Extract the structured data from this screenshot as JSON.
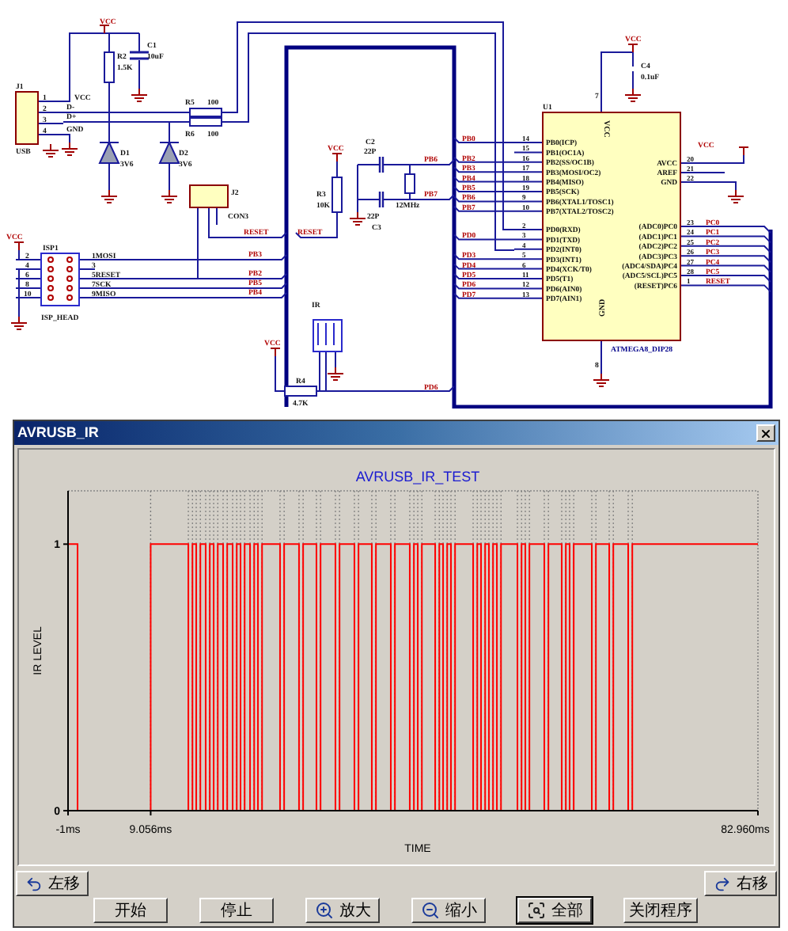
{
  "schematic": {
    "labels": [
      {
        "kind": "power",
        "text": "VCC"
      },
      {
        "kind": "ref",
        "text": "C1"
      },
      {
        "kind": "ref",
        "text": "10uF"
      },
      {
        "kind": "ref",
        "text": "R2"
      },
      {
        "kind": "ref",
        "text": "1.5K"
      },
      {
        "kind": "ref",
        "text": "J1"
      },
      {
        "kind": "pin",
        "text": "1"
      },
      {
        "kind": "pin",
        "text": "2"
      },
      {
        "kind": "pin",
        "text": "3"
      },
      {
        "kind": "pin",
        "text": "4"
      },
      {
        "kind": "ref",
        "text": "VCC"
      },
      {
        "kind": "ref",
        "text": "D-"
      },
      {
        "kind": "ref",
        "text": "D+"
      },
      {
        "kind": "ref",
        "text": "GND"
      },
      {
        "kind": "ref",
        "text": "USB"
      },
      {
        "kind": "ref",
        "text": "R5"
      },
      {
        "kind": "ref",
        "text": "100"
      },
      {
        "kind": "ref",
        "text": "R6"
      },
      {
        "kind": "ref",
        "text": "100"
      },
      {
        "kind": "ref",
        "text": "D1"
      },
      {
        "kind": "ref",
        "text": "3V6"
      },
      {
        "kind": "ref",
        "text": "D2"
      },
      {
        "kind": "ref",
        "text": "3V6"
      },
      {
        "kind": "ref",
        "text": "J2"
      },
      {
        "kind": "ref",
        "text": "CON3"
      },
      {
        "kind": "power",
        "text": "VCC"
      },
      {
        "kind": "ref",
        "text": "ISP1"
      },
      {
        "kind": "pin",
        "text": "2"
      },
      {
        "kind": "pin",
        "text": "4"
      },
      {
        "kind": "pin",
        "text": "6"
      },
      {
        "kind": "pin",
        "text": "8"
      },
      {
        "kind": "pin",
        "text": "10"
      },
      {
        "kind": "ref",
        "text": "1MOSI"
      },
      {
        "kind": "ref",
        "text": "3"
      },
      {
        "kind": "ref",
        "text": "5RESET"
      },
      {
        "kind": "ref",
        "text": "7SCK"
      },
      {
        "kind": "ref",
        "text": "9MISO"
      },
      {
        "kind": "ref",
        "text": "ISP_HEAD"
      },
      {
        "kind": "net",
        "text": "RESET"
      },
      {
        "kind": "net",
        "text": "RESET"
      },
      {
        "kind": "net",
        "text": "PB3"
      },
      {
        "kind": "net",
        "text": "PB2"
      },
      {
        "kind": "net",
        "text": "PB5"
      },
      {
        "kind": "net",
        "text": "PB4"
      },
      {
        "kind": "power",
        "text": "VCC"
      },
      {
        "kind": "ref",
        "text": "R3"
      },
      {
        "kind": "ref",
        "text": "10K"
      },
      {
        "kind": "ref",
        "text": "C2"
      },
      {
        "kind": "ref",
        "text": "22P"
      },
      {
        "kind": "ref",
        "text": "22P"
      },
      {
        "kind": "ref",
        "text": "C3"
      },
      {
        "kind": "ref",
        "text": "12MHz"
      },
      {
        "kind": "net",
        "text": "PB6"
      },
      {
        "kind": "net",
        "text": "PB7"
      },
      {
        "kind": "ref",
        "text": "IR"
      },
      {
        "kind": "power",
        "text": "VCC"
      },
      {
        "kind": "ref",
        "text": "R4"
      },
      {
        "kind": "ref",
        "text": "4.7K"
      },
      {
        "kind": "net",
        "text": "PD6"
      },
      {
        "kind": "power",
        "text": "VCC"
      },
      {
        "kind": "ref",
        "text": "C4"
      },
      {
        "kind": "ref",
        "text": "0.1uF"
      },
      {
        "kind": "pin",
        "text": "7"
      },
      {
        "kind": "ref",
        "text": "U1"
      },
      {
        "kind": "power",
        "text": "VCC"
      },
      {
        "kind": "chip",
        "text": "ATMEGA8_DIP28"
      },
      {
        "kind": "pin",
        "text": "8"
      }
    ],
    "chip": {
      "power_label": "VCC",
      "ground_label": "GND",
      "left_pins": [
        {
          "num": "14",
          "name": "PB0(ICP)",
          "net": "PB0"
        },
        {
          "num": "15",
          "name": "PB1(OC1A)"
        },
        {
          "num": "16",
          "name": "PB2(SS/OC1B)",
          "net": "PB2"
        },
        {
          "num": "17",
          "name": "PB3(MOSI/OC2)",
          "net": "PB3"
        },
        {
          "num": "18",
          "name": "PB4(MISO)",
          "net": "PB4"
        },
        {
          "num": "19",
          "name": "PB5(SCK)",
          "net": "PB5"
        },
        {
          "num": "9",
          "name": "PB6(XTAL1/TOSC1)",
          "net": "PB6"
        },
        {
          "num": "10",
          "name": "PB7(XTAL2/TOSC2)",
          "net": "PB7"
        },
        {
          "num": "2",
          "name": "PD0(RXD)"
        },
        {
          "num": "3",
          "name": "PD1(TXD)",
          "net": "PD0"
        },
        {
          "num": "4",
          "name": "PD2(INT0)"
        },
        {
          "num": "5",
          "name": "PD3(INT1)",
          "net": "PD3"
        },
        {
          "num": "6",
          "name": "PD4(XCK/T0)",
          "net": "PD4"
        },
        {
          "num": "11",
          "name": "PD5(T1)",
          "net": "PD5"
        },
        {
          "num": "12",
          "name": "PD6(AIN0)",
          "net": "PD6"
        },
        {
          "num": "13",
          "name": "PD7(AIN1)",
          "net": "PD7"
        }
      ],
      "right_pins": [
        {
          "num": "20",
          "name": "AVCC"
        },
        {
          "num": "21",
          "name": "AREF"
        },
        {
          "num": "22",
          "name": "GND"
        },
        {
          "num": "23",
          "name": "(ADC0)PC0",
          "net": "PC0"
        },
        {
          "num": "24",
          "name": "(ADC1)PC1",
          "net": "PC1"
        },
        {
          "num": "25",
          "name": "(ADC2)PC2",
          "net": "PC2"
        },
        {
          "num": "26",
          "name": "(ADC3)PC3",
          "net": "PC3"
        },
        {
          "num": "27",
          "name": "(ADC4/SDA)PC4",
          "net": "PC4"
        },
        {
          "num": "28",
          "name": "(ADC5/SCL)PC5",
          "net": "PC5"
        },
        {
          "num": "1",
          "name": "(RESET)PC6",
          "net": "RESET"
        }
      ]
    }
  },
  "window": {
    "title": "AVRUSB_IR",
    "chart": {
      "chart_data": {
        "type": "line",
        "title": "AVRUSB_IR_TEST",
        "xlabel": "TIME",
        "ylabel": "IR LEVEL",
        "xlim": [
          -1,
          82.96
        ],
        "ylim": [
          0,
          1.2
        ],
        "xticks": [
          {
            "value": -1,
            "label": "-1ms"
          },
          {
            "value": 9.056,
            "label": "9.056ms"
          },
          {
            "value": 82.96,
            "label": "82.960ms"
          }
        ],
        "yticks": [
          0,
          1
        ],
        "x": [
          -1,
          0.16,
          0.16,
          9.056,
          9.056,
          13.64,
          13.64,
          14.14,
          14.14,
          14.6,
          14.6,
          15.1,
          15.1,
          15.75,
          15.75,
          16.25,
          16.25,
          16.72,
          16.72,
          17.22,
          17.22,
          17.87,
          17.87,
          18.37,
          18.37,
          19.03,
          19.03,
          19.53,
          19.53,
          19.99,
          19.99,
          20.49,
          20.49,
          21.15,
          21.15,
          21.65,
          21.65,
          22.11,
          22.11,
          22.61,
          22.61,
          24.8,
          24.8,
          25.3,
          25.3,
          27.11,
          27.11,
          27.61,
          27.61,
          29.23,
          29.23,
          29.73,
          29.73,
          31.54,
          31.54,
          32.04,
          32.04,
          33.85,
          33.85,
          34.35,
          34.35,
          35.97,
          35.97,
          36.47,
          36.47,
          38.28,
          38.28,
          38.78,
          38.78,
          40.59,
          40.59,
          41.09,
          41.09,
          41.56,
          41.56,
          42.06,
          42.06,
          43.68,
          43.68,
          44.18,
          44.18,
          44.64,
          44.64,
          45.14,
          45.14,
          45.6,
          45.6,
          46.1,
          46.1,
          48.3,
          48.3,
          48.8,
          48.8,
          49.26,
          49.26,
          49.76,
          49.76,
          50.22,
          50.22,
          50.72,
          50.72,
          51.19,
          51.19,
          51.69,
          51.69,
          53.69,
          53.69,
          54.19,
          54.19,
          54.65,
          54.65,
          55.15,
          55.15,
          56.96,
          56.96,
          57.46,
          57.46,
          59.08,
          59.08,
          59.58,
          59.58,
          60.04,
          60.04,
          60.54,
          60.54,
          62.74,
          62.74,
          63.24,
          63.24,
          64.86,
          64.86,
          65.36,
          65.36,
          67.17,
          67.17,
          67.67,
          67.67,
          82.96
        ],
        "series": [
          {
            "color": "#ff0000",
            "values": [
              1,
              1,
              0,
              0,
              1,
              1,
              0,
              0,
              1,
              1,
              0,
              0,
              1,
              1,
              0,
              0,
              1,
              1,
              0,
              0,
              1,
              1,
              0,
              0,
              1,
              1,
              0,
              0,
              1,
              1,
              0,
              0,
              1,
              1,
              0,
              0,
              1,
              1,
              0,
              0,
              1,
              1,
              0,
              0,
              1,
              1,
              0,
              0,
              1,
              1,
              0,
              0,
              1,
              1,
              0,
              0,
              1,
              1,
              0,
              0,
              1,
              1,
              0,
              0,
              1,
              1,
              0,
              0,
              1,
              1,
              0,
              0,
              1,
              1,
              0,
              0,
              1,
              1,
              0,
              0,
              1,
              1,
              0,
              0,
              1,
              1,
              0,
              0,
              1,
              1,
              0,
              0,
              1,
              1,
              0,
              0,
              1,
              1,
              0,
              0,
              1,
              1,
              0,
              0,
              1,
              1,
              0,
              0,
              1,
              1,
              0,
              0,
              1,
              1,
              0,
              0,
              1,
              1,
              0,
              0,
              1,
              1,
              0,
              0,
              1,
              1,
              0,
              0,
              1,
              1,
              0,
              0,
              1,
              1,
              0,
              0,
              1,
              1
            ]
          }
        ]
      }
    },
    "pan_buttons": [
      {
        "kind": "left",
        "label": "左移",
        "focused": false
      },
      {
        "kind": "right",
        "label": "右移",
        "focused": false
      }
    ],
    "buttons": [
      {
        "kind": "plain",
        "label": "开始",
        "focused": false
      },
      {
        "kind": "plain",
        "label": "停止",
        "focused": false
      },
      {
        "kind": "zoomin",
        "label": "放大",
        "focused": false
      },
      {
        "kind": "zoomout",
        "label": "缩小",
        "focused": false
      },
      {
        "kind": "fit",
        "label": "全部",
        "focused": true
      },
      {
        "kind": "plain",
        "label": "关闭程序",
        "focused": false
      }
    ]
  }
}
